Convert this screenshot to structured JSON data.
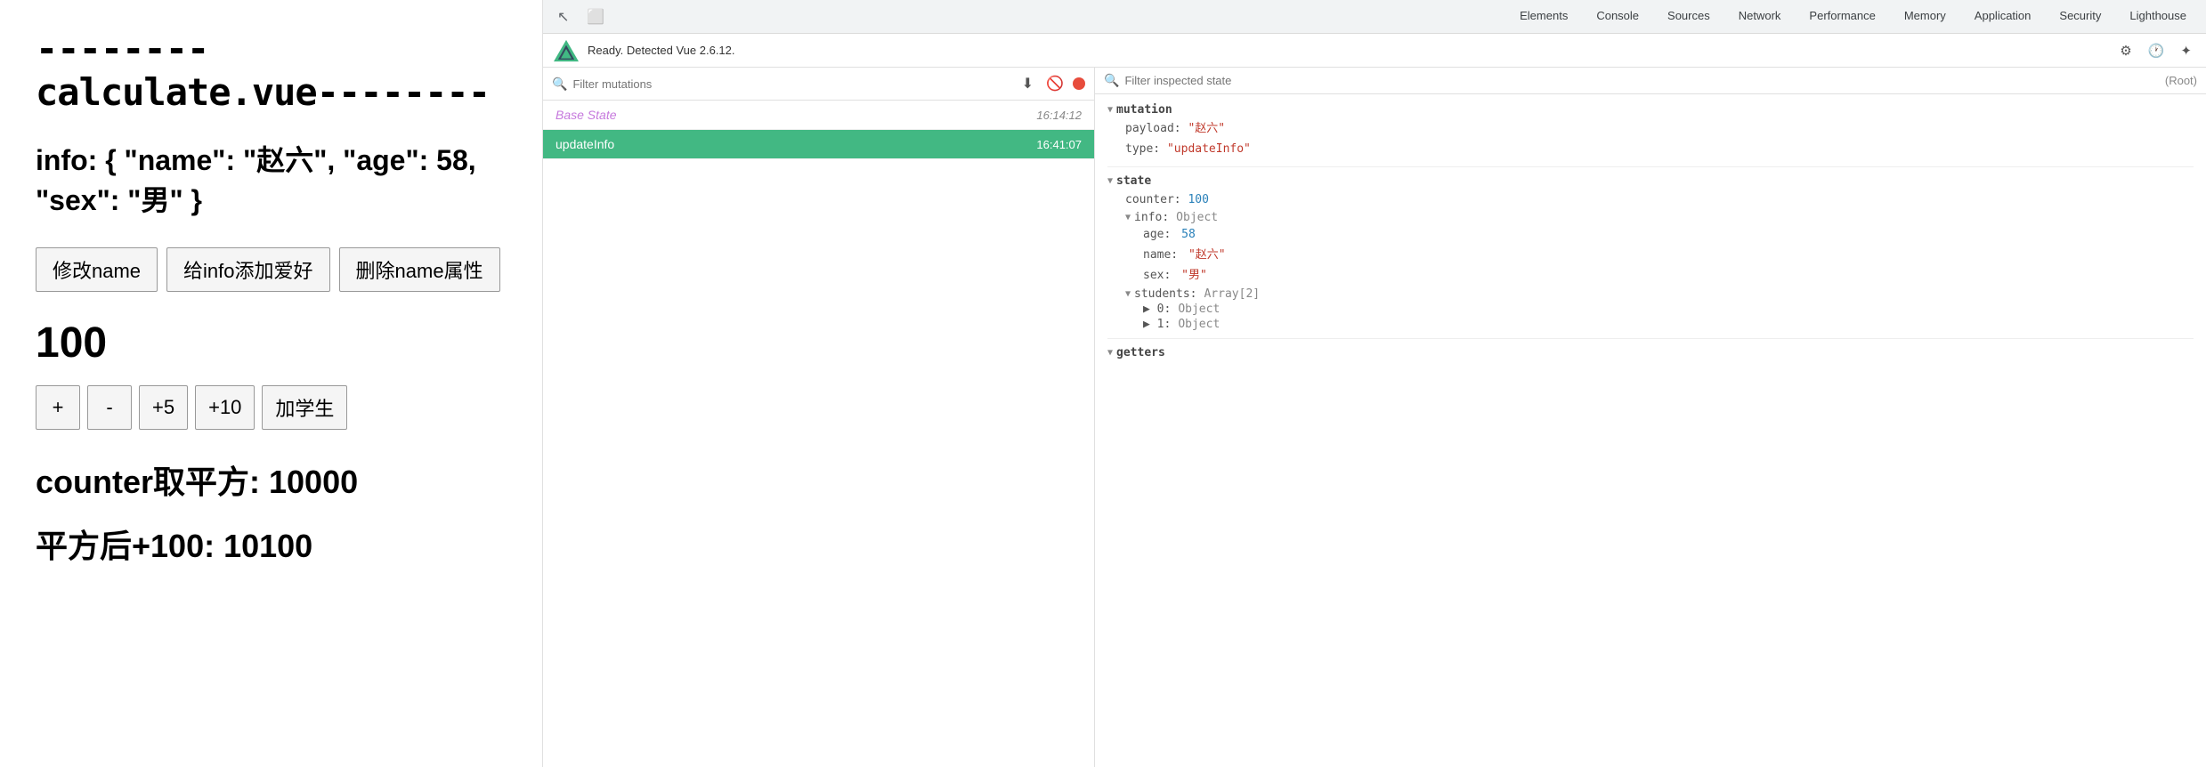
{
  "left": {
    "title": "--------calculate.vue--------",
    "info_label": "info: { \"name\": \"赵六\", \"age\": 58,",
    "info_label2": "\"sex\": \"男\" }",
    "buttons": [
      {
        "id": "modify-name",
        "label": "修改name"
      },
      {
        "id": "add-hobby",
        "label": "给info添加爱好"
      },
      {
        "id": "delete-name",
        "label": "删除name属性"
      }
    ],
    "counter": "100",
    "counter_buttons": [
      {
        "id": "plus",
        "label": "+"
      },
      {
        "id": "minus",
        "label": "-"
      },
      {
        "id": "plus5",
        "label": "+5"
      },
      {
        "id": "plus10",
        "label": "+10"
      },
      {
        "id": "add-student",
        "label": "加学生"
      }
    ],
    "computed1": "counter取平方: 10000",
    "computed2": "平方后+100: 10100"
  },
  "devtools": {
    "nav_tabs": [
      {
        "id": "elements",
        "label": "Elements",
        "active": false
      },
      {
        "id": "console",
        "label": "Console",
        "active": false
      },
      {
        "id": "sources",
        "label": "Sources",
        "active": false
      },
      {
        "id": "network",
        "label": "Network",
        "active": false
      },
      {
        "id": "performance",
        "label": "Performance",
        "active": false
      },
      {
        "id": "memory",
        "label": "Memory",
        "active": false
      },
      {
        "id": "application",
        "label": "Application",
        "active": false
      },
      {
        "id": "security",
        "label": "Security",
        "active": false
      },
      {
        "id": "lighthouse",
        "label": "Lighthouse",
        "active": false
      }
    ],
    "vue_status": "Ready. Detected Vue 2.6.12.",
    "filter_mutations_placeholder": "Filter mutations",
    "filter_state_placeholder": "Filter inspected state",
    "root_label": "(Root)",
    "mutations": [
      {
        "id": "base-state",
        "name": "Base State",
        "time": "16:14:12",
        "is_base": true,
        "active": false
      },
      {
        "id": "update-info",
        "name": "updateInfo",
        "time": "16:41:07",
        "is_base": false,
        "active": true
      }
    ],
    "mutation_section": {
      "name": "mutation",
      "payload_key": "payload:",
      "payload_value": "\"赵六\"",
      "type_key": "type:",
      "type_value": "\"updateInfo\""
    },
    "state_section": {
      "name": "state",
      "counter_key": "counter:",
      "counter_value": "100",
      "info_key": "info:",
      "info_type": "Object",
      "age_key": "age:",
      "age_value": "58",
      "name_key": "name:",
      "name_value": "\"赵六\"",
      "sex_key": "sex:",
      "sex_value": "\"男\"",
      "students_key": "students:",
      "students_type": "Array[2]",
      "student0_key": "▶ 0:",
      "student0_value": "Object",
      "student1_key": "▶ 1:",
      "student1_value": "Object"
    },
    "getters_section_name": "getters"
  }
}
